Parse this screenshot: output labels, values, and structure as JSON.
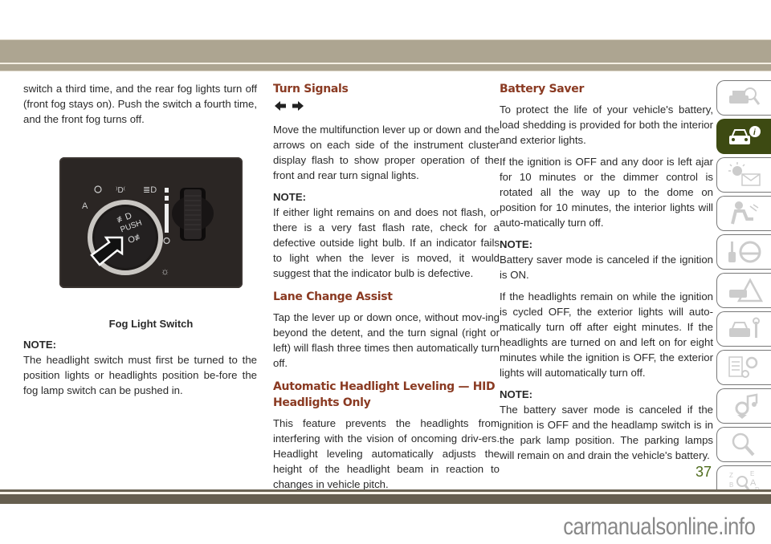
{
  "header": {},
  "column1": {
    "intro": "switch a third time, and the rear fog lights turn off (front fog stays on). Push the switch a fourth time, and the front fog turns off.",
    "figure": {
      "caption": "Fog Light Switch",
      "push_label": "PUSH",
      "auto_label": "A"
    },
    "note_label": "NOTE:",
    "note_text": "The headlight switch must first be turned to the position lights or headlights position be-fore the fog lamp switch can be pushed in."
  },
  "column2": {
    "turn_signals": {
      "heading": "Turn Signals",
      "icon": "left-right-arrows-icon",
      "body": "Move the multifunction lever up or down and the arrows on each side of the instrument cluster display flash to show proper operation of the front and rear turn signal lights.",
      "note_label": "NOTE:",
      "note_text": "If either light remains on and does not flash, or there is a very fast flash rate, check for a defective outside light bulb. If an indicator fails to light when the lever is moved, it would suggest that the indicator bulb is defective."
    },
    "lane_change": {
      "heading": "Lane Change Assist",
      "body": "Tap the lever up or down once, without mov-ing beyond the detent, and the turn signal (right or left) will flash three times then automatically turn off."
    },
    "headlight_leveling": {
      "heading": "Automatic Headlight Leveling — HID Headlights Only",
      "body": "This feature prevents the headlights from interfering with the vision of oncoming driv-ers. Headlight leveling automatically adjusts the height of the headlight beam in reaction to changes in vehicle pitch."
    }
  },
  "column3": {
    "heading": "Battery Saver",
    "p1": "To protect the life of your vehicle's battery, load shedding is provided for both the interior and exterior lights.",
    "p2": "If the ignition is OFF and any door is left ajar for 10 minutes or the dimmer control is rotated all the way up to the dome on position for 10 minutes, the interior lights will auto-matically turn off.",
    "note1_label": "NOTE:",
    "note1_text": "Battery saver mode is canceled if the ignition is ON.",
    "p3": "If the headlights remain on while the ignition is cycled OFF, the exterior lights will auto-matically turn off after eight minutes. If the headlights are turned on and left on for eight minutes while the ignition is OFF, the exterior lights will automatically turn off.",
    "note2_label": "NOTE:",
    "note2_text": "The battery saver mode is canceled if the ignition is OFF and the headlamp switch is in the park lamp position. The parking lamps will remain on and drain the vehicle's battery."
  },
  "side_tabs": [
    {
      "icon": "car-search-icon",
      "active": false
    },
    {
      "icon": "car-info-icon",
      "active": true
    },
    {
      "icon": "warning-light-message-icon",
      "active": false
    },
    {
      "icon": "airbag-seat-icon",
      "active": false
    },
    {
      "icon": "key-steering-wheel-icon",
      "active": false
    },
    {
      "icon": "car-warning-triangle-icon",
      "active": false
    },
    {
      "icon": "car-wrench-icon",
      "active": false
    },
    {
      "icon": "specs-gears-icon",
      "active": false
    },
    {
      "icon": "multimedia-music-icon",
      "active": false
    },
    {
      "icon": "search-magnifier-icon",
      "active": false
    },
    {
      "icon": "index-alphabet-icon",
      "active": false
    }
  ],
  "footer": {
    "page_number": "37",
    "watermark": "carmanualsonline.info"
  },
  "colors": {
    "heading": "#8a3a22",
    "active_tab": "#3d4a12",
    "page_number": "#4e6b1c",
    "band": "#ada591"
  }
}
